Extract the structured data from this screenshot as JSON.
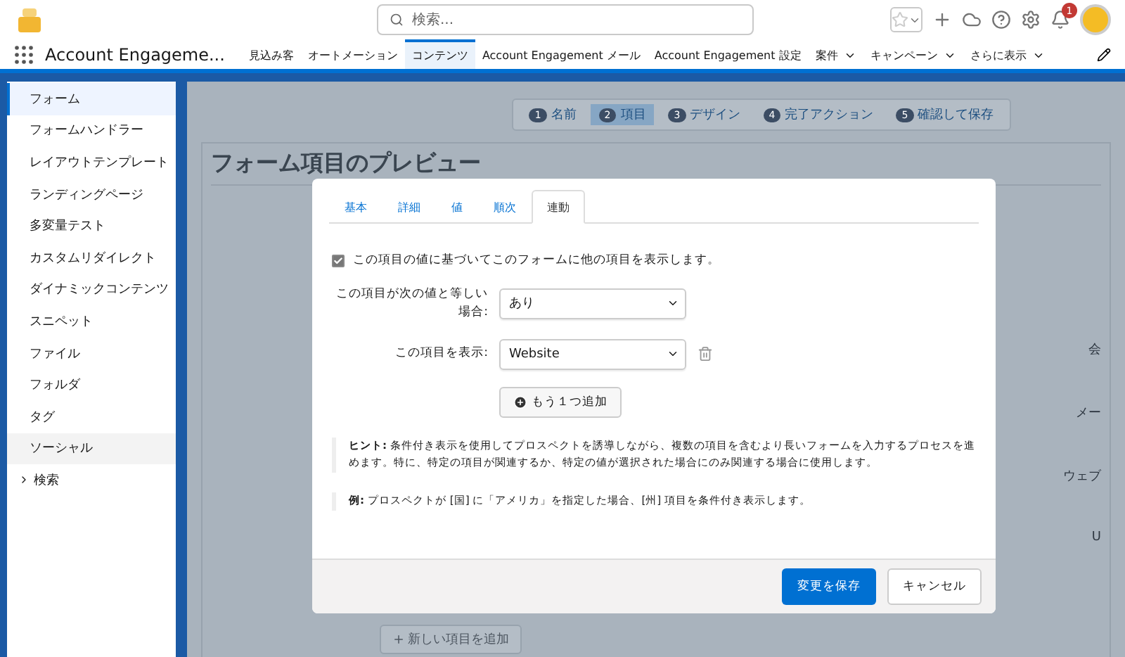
{
  "header": {
    "search_placeholder": "検索...",
    "notification_count": "1"
  },
  "nav": {
    "app_name": "Account Engageme...",
    "items": [
      {
        "label": "見込み客",
        "selected": false,
        "dropdown": false
      },
      {
        "label": "オートメーション",
        "selected": false,
        "dropdown": false
      },
      {
        "label": "コンテンツ",
        "selected": true,
        "dropdown": false
      },
      {
        "label": "Account Engagement メール",
        "selected": false,
        "dropdown": false
      },
      {
        "label": "Account Engagement 設定",
        "selected": false,
        "dropdown": false
      },
      {
        "label": "案件",
        "selected": false,
        "dropdown": true
      },
      {
        "label": "キャンペーン",
        "selected": false,
        "dropdown": true
      },
      {
        "label": "さらに表示",
        "selected": false,
        "dropdown": true
      }
    ]
  },
  "sidebar": {
    "items": [
      {
        "label": "フォーム",
        "selected": true,
        "hovered": false,
        "kind": "link"
      },
      {
        "label": "フォームハンドラー",
        "selected": false,
        "hovered": false,
        "kind": "link"
      },
      {
        "label": "レイアウトテンプレート",
        "selected": false,
        "hovered": false,
        "kind": "link"
      },
      {
        "label": "ランディングページ",
        "selected": false,
        "hovered": false,
        "kind": "link"
      },
      {
        "label": "多変量テスト",
        "selected": false,
        "hovered": false,
        "kind": "link"
      },
      {
        "label": "カスタムリダイレクト",
        "selected": false,
        "hovered": false,
        "kind": "link"
      },
      {
        "label": "ダイナミックコンテンツ",
        "selected": false,
        "hovered": false,
        "kind": "link"
      },
      {
        "label": "スニペット",
        "selected": false,
        "hovered": false,
        "kind": "link"
      },
      {
        "label": "ファイル",
        "selected": false,
        "hovered": false,
        "kind": "link"
      },
      {
        "label": "フォルダ",
        "selected": false,
        "hovered": false,
        "kind": "link"
      },
      {
        "label": "タグ",
        "selected": false,
        "hovered": false,
        "kind": "link"
      },
      {
        "label": "ソーシャル",
        "selected": false,
        "hovered": true,
        "kind": "link"
      },
      {
        "label": "検索",
        "selected": false,
        "hovered": false,
        "kind": "group"
      }
    ]
  },
  "wizard": {
    "steps": [
      {
        "number": "1",
        "label": "名前",
        "selected": false
      },
      {
        "number": "2",
        "label": "項目",
        "selected": true
      },
      {
        "number": "3",
        "label": "デザイン",
        "selected": false
      },
      {
        "number": "4",
        "label": "完了アクション",
        "selected": false
      },
      {
        "number": "5",
        "label": "確認して保存",
        "selected": false
      }
    ]
  },
  "preview": {
    "title": "フォーム項目のプレビュー",
    "field_labels": [
      "会",
      "メー",
      "ウェブ",
      "U"
    ],
    "add_button": "新しい項目を追加"
  },
  "modal": {
    "tabs": [
      {
        "label": "基本",
        "selected": false
      },
      {
        "label": "詳細",
        "selected": false
      },
      {
        "label": "値",
        "selected": false
      },
      {
        "label": "順次",
        "selected": false
      },
      {
        "label": "連動",
        "selected": true
      }
    ],
    "checkbox": {
      "label": "この項目の値に基づいてこのフォームに他の項目を表示します。",
      "checked": true
    },
    "rows": [
      {
        "label": "この項目が次の値と等しい場合:",
        "value": "あり",
        "deletable": false
      },
      {
        "label": "この項目を表示:",
        "value": "Website",
        "deletable": true
      }
    ],
    "add_more": "もう１つ追加",
    "notes": [
      {
        "text": "**ヒント:** 条件付き表示を使用してプロスペクトを誘導しながら、複数の項目を含むより長いフォームを入力するプロセスを進めます。特に、特定の項目が関連するか、特定の値が選択された場合にのみ関連する場合に使用します。"
      },
      {
        "text": "**例:** プロスペクトが [国] に「アメリカ」を指定した場合、[州] 項目を条件付き表示します。"
      }
    ],
    "save_button": "変更を保存",
    "cancel_button": "キャンセル"
  }
}
